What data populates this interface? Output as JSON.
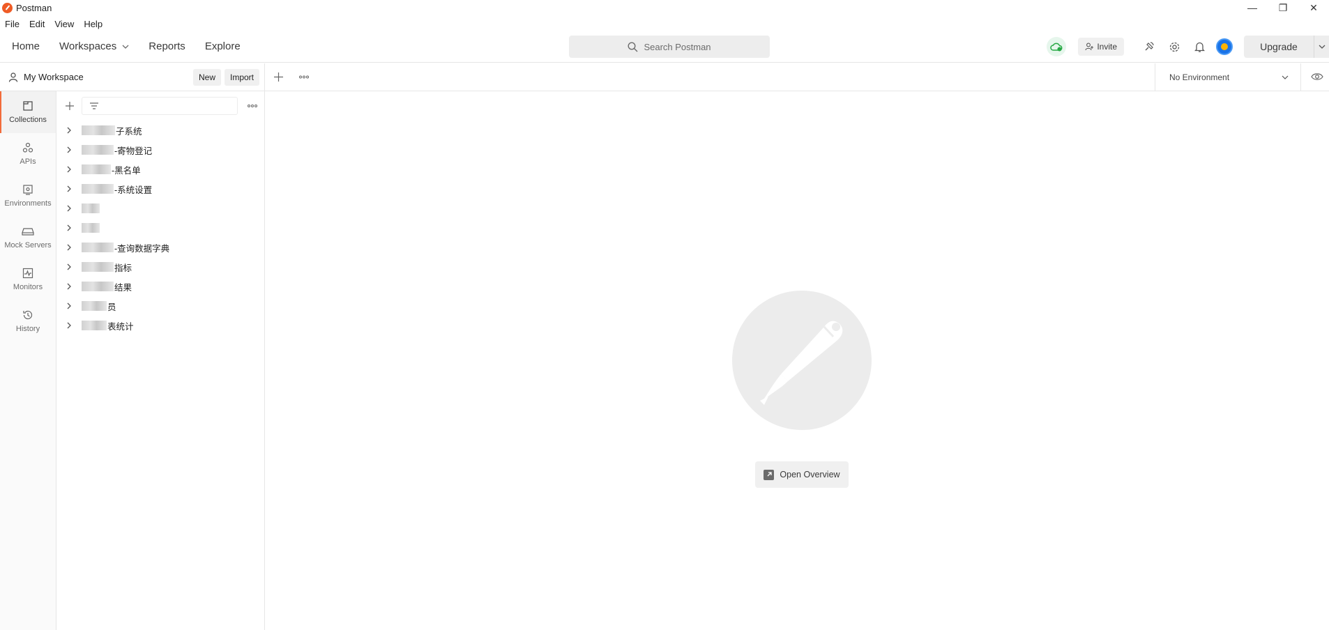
{
  "window": {
    "title": "Postman",
    "controls": {
      "minimize": "—",
      "restore": "❐",
      "close": "✕"
    }
  },
  "menu": [
    "File",
    "Edit",
    "View",
    "Help"
  ],
  "header": {
    "nav": {
      "home": "Home",
      "workspaces": "Workspaces",
      "reports": "Reports",
      "explore": "Explore"
    },
    "search_placeholder": "Search Postman",
    "invite_label": "Invite",
    "upgrade_label": "Upgrade"
  },
  "workspace": {
    "name": "My Workspace",
    "new_label": "New",
    "import_label": "Import"
  },
  "environment": {
    "selected": "No Environment"
  },
  "rail": [
    {
      "label": "Collections",
      "icon": "collections-icon",
      "active": true
    },
    {
      "label": "APIs",
      "icon": "apis-icon"
    },
    {
      "label": "Environments",
      "icon": "environments-icon"
    },
    {
      "label": "Mock Servers",
      "icon": "mock-servers-icon"
    },
    {
      "label": "Monitors",
      "icon": "monitors-icon"
    },
    {
      "label": "History",
      "icon": "history-icon"
    }
  ],
  "collections": [
    {
      "visible_suffix": "子系统"
    },
    {
      "visible_suffix": "-寄物登记"
    },
    {
      "visible_suffix": "-黑名单"
    },
    {
      "visible_suffix": "-系统设置"
    },
    {
      "visible_suffix": ""
    },
    {
      "visible_suffix": ""
    },
    {
      "visible_suffix": "-查询数据字典"
    },
    {
      "visible_suffix": "指标"
    },
    {
      "visible_suffix": "结果"
    },
    {
      "visible_suffix": "员"
    },
    {
      "visible_suffix": "表统计"
    }
  ],
  "main": {
    "open_overview_label": "Open Overview"
  },
  "colors": {
    "brand": "#ef5b25",
    "active_tab_accent": "#f26b3a",
    "sync_ok": "#27a844"
  }
}
